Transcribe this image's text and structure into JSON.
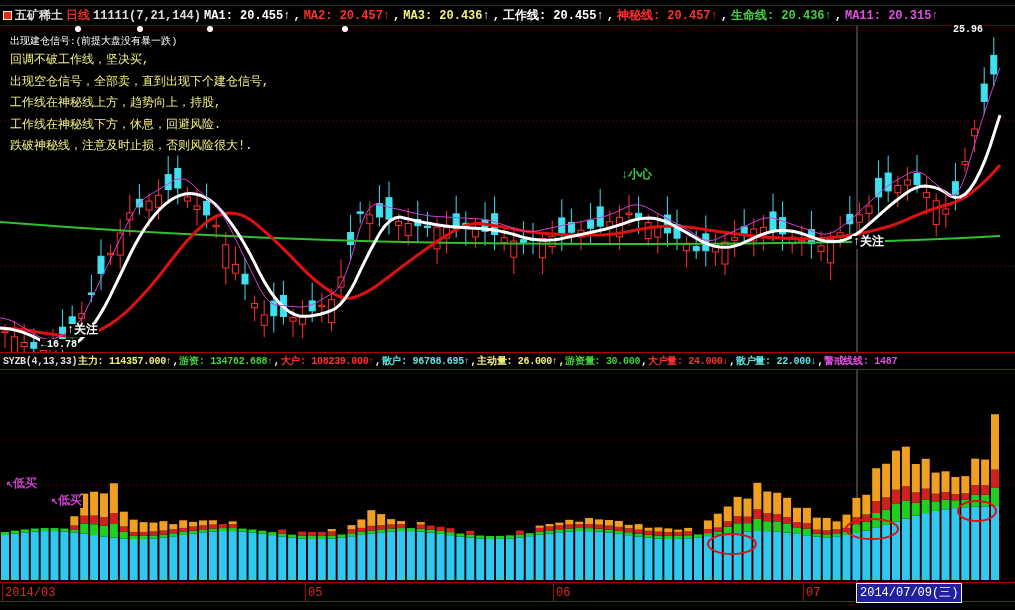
{
  "title_bar": {
    "stock": "五矿稀土",
    "period": "日线",
    "params": "11111(7,21,144)",
    "indicators": [
      {
        "label": "MA1:",
        "value": "20.455↑",
        "sep": ",",
        "color": "#ffffff"
      },
      {
        "label": "MA2:",
        "value": "20.457↑",
        "sep": ",",
        "color": "#ff3030"
      },
      {
        "label": "MA3:",
        "value": "20.436↑",
        "sep": ",",
        "color": "#f0f080"
      },
      {
        "label": "工作线:",
        "value": "20.455↑",
        "sep": ",",
        "color": "#ffffff"
      },
      {
        "label": "神秘线:",
        "value": "20.457↑",
        "sep": ",",
        "color": "#ff3030"
      },
      {
        "label": "生命线:",
        "value": "20.436↑",
        "sep": ",",
        "color": "#40d040"
      },
      {
        "label": "MA11:",
        "value": "20.315↑",
        "color": "#e050e0"
      }
    ]
  },
  "notes": {
    "heading": "出现建仓信号:(前提大盘没有暴一跌)",
    "lines": [
      "回调不破工作线，坚决买,",
      "出现空仓信号，全部卖，直到出现下个建仓信号,",
      "工作线在神秘线上方，趋势向上，持股,",
      "工作线在神秘线下方，休息，回避风险.",
      "跌破神秘线，注意及时止损，否则风险很大!."
    ]
  },
  "chart_labels": [
    {
      "text": "↓小心",
      "color": "#40d040"
    },
    {
      "text": "↑关注",
      "color": "#ffffff"
    },
    {
      "text": "↑关注",
      "color": "#ffffff"
    },
    {
      "text": "←16.78",
      "color": "#ffffff"
    },
    {
      "text": "25.96",
      "color": "#ffffff"
    }
  ],
  "indicator_bar": {
    "name": "SYZB(4,13,33)",
    "items": [
      {
        "label": "主力:",
        "value": "114357.000↑",
        "sep": ",",
        "color": "#f0f080"
      },
      {
        "label": "游资:",
        "value": "134762.688↑",
        "sep": ",",
        "color": "#40d040"
      },
      {
        "label": "大户:",
        "value": "108239.000↑",
        "sep": ",",
        "color": "#ff3030"
      },
      {
        "label": "散户:",
        "value": "96788.695↑",
        "sep": ",",
        "color": "#60e0e0"
      },
      {
        "label": "主动量:",
        "value": "26.000↑",
        "sep": ",",
        "color": "#f0f080"
      },
      {
        "label": "游资量:",
        "value": "30.000",
        "sep": ",",
        "color": "#40d040"
      },
      {
        "label": "大户量:",
        "value": "24.000↓",
        "sep": ",",
        "color": "#ff3030"
      },
      {
        "label": "散户量:",
        "value": "22.000↓",
        "sep": ",",
        "color": "#60e0e0"
      },
      {
        "label": "警戒线线:",
        "value": "1487",
        "color": "#e050e0"
      }
    ]
  },
  "lower_labels": [
    {
      "text": "↖低买"
    },
    {
      "text": "↖低买"
    }
  ],
  "time_axis": {
    "labels": [
      "2014/03",
      "05",
      "06",
      "07"
    ],
    "cursor_date": "2014/07/09(三)"
  }
}
